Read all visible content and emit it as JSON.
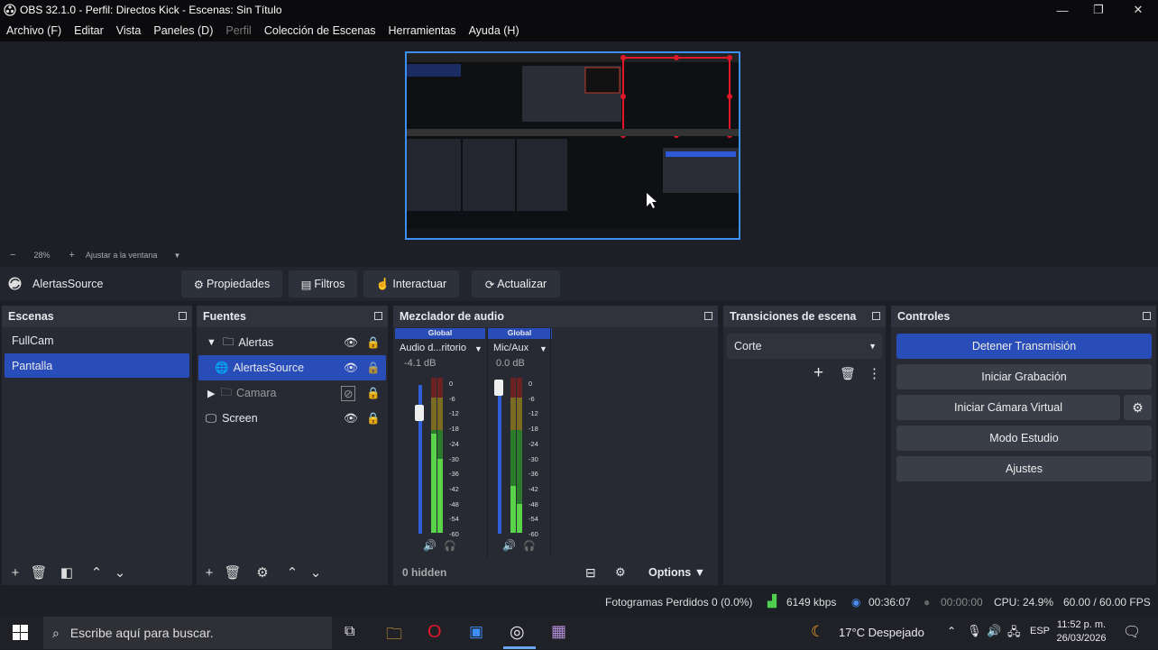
{
  "window": {
    "title": "OBS 32.1.0 - Perfil: Directos Kick - Escenas: Sin Título"
  },
  "menu": [
    "Archivo (F)",
    "Editar",
    "Vista",
    "Paneles (D)",
    "Perfil",
    "Colección de Escenas",
    "Herramientas",
    "Ayuda (H)"
  ],
  "zoom": {
    "percent": "28%",
    "fit_label": "Ajustar a la ventana"
  },
  "source_toolbar": {
    "selected": "AlertasSource",
    "properties": "Propiedades",
    "filters": "Filtros",
    "interact": "Interactuar",
    "refresh": "Actualizar"
  },
  "scenes": {
    "title": "Escenas",
    "items": [
      "FullCam",
      "Pantalla"
    ]
  },
  "sources": {
    "title": "Fuentes",
    "items": [
      "Alertas",
      "AlertasSource",
      "Camara",
      "Screen"
    ]
  },
  "mixer": {
    "title": "Mezclador de audio",
    "channels": [
      {
        "badge": "Global",
        "name": "Audio d...ritorio",
        "db": "-4.1 dB"
      },
      {
        "badge": "Global",
        "name": "Mic/Aux",
        "db": "0.0 dB"
      }
    ],
    "scale": [
      "0",
      "-6",
      "-12",
      "-18",
      "-24",
      "-30",
      "-36",
      "-42",
      "-48",
      "-54",
      "-60"
    ],
    "hidden": "0 hidden",
    "options": "Options"
  },
  "transitions": {
    "title": "Transiciones de escena",
    "current": "Corte"
  },
  "controls": {
    "title": "Controles",
    "stop_stream": "Detener Transmisión",
    "start_recording": "Iniciar Grabación",
    "virtual_cam": "Iniciar Cámara Virtual",
    "studio_mode": "Modo Estudio",
    "settings": "Ajustes"
  },
  "status": {
    "dropped": "Fotogramas Perdidos 0 (0.0%)",
    "bitrate": "6149 kbps",
    "stream_time": "00:36:07",
    "rec_time": "00:00:00",
    "cpu": "CPU: 24.9%",
    "fps": "60.00 / 60.00 FPS"
  },
  "taskbar": {
    "search_placeholder": "Escribe aquí para buscar.",
    "weather": "17°C  Despejado",
    "lang": "ESP",
    "time": "11:52 p. m.",
    "date": "26/03/2026"
  },
  "colors": {
    "accent": "#284cb8",
    "bg": "#1d1f26",
    "panel": "#272a33"
  }
}
